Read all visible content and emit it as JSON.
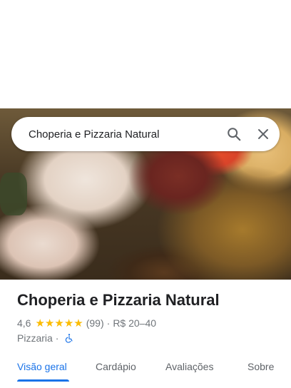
{
  "search": {
    "query": "Choperia e Pizzaria Natural"
  },
  "place": {
    "name": "Choperia e Pizzaria Natural",
    "rating": "4,6",
    "stars": 4.6,
    "reviews": "(99)",
    "separator": "·",
    "price": "R$ 20–40",
    "category": "Pizzaria",
    "category_separator": "·"
  },
  "tabs": [
    {
      "label": "Visão geral",
      "active": true
    },
    {
      "label": "Cardápio"
    },
    {
      "label": "Avaliações"
    },
    {
      "label": "Sobre"
    }
  ],
  "colors": {
    "accent": "#1a73e8",
    "star": "#fbbc04",
    "text": "#202124",
    "secondary": "#70757a"
  },
  "icons": {
    "search": "search-icon",
    "close": "close-icon",
    "accessibility": "wheelchair-icon",
    "photo": "food-photo"
  }
}
